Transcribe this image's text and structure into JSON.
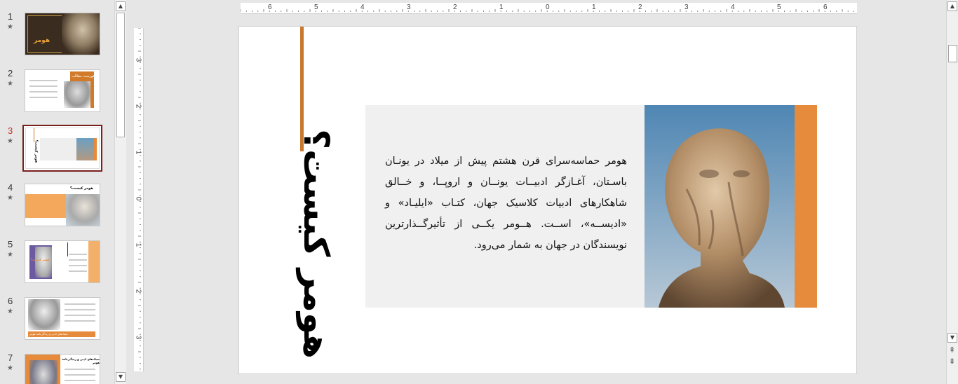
{
  "slides": [
    {
      "number": "1",
      "star": "★",
      "title": "هومر"
    },
    {
      "number": "2",
      "star": "★",
      "title": "فهرست مطالب"
    },
    {
      "number": "3",
      "star": "★",
      "title": "هومر کیست؟"
    },
    {
      "number": "4",
      "star": "★",
      "title": "هومر کیست؟"
    },
    {
      "number": "5",
      "star": "★",
      "title": "هومر کیست؟"
    },
    {
      "number": "6",
      "star": "★",
      "title": "سبک‌های ادبی و زندگی‌نامه هومر"
    },
    {
      "number": "7",
      "star": "★",
      "title": "سبک‌های ادبی و زندگی‌نامه هومر"
    }
  ],
  "selected_slide": "3",
  "ruler": {
    "horizontal": [
      "6",
      "5",
      "4",
      "3",
      "2",
      "1",
      "0",
      "1",
      "2",
      "3",
      "4",
      "5",
      "6"
    ],
    "vertical": [
      "3",
      "2",
      "1",
      "0",
      "1",
      "2",
      "3"
    ]
  },
  "slide": {
    "title": "هومر کیست؟",
    "body": "هومر حماسه‌سرای قرن هشتم پیش از میلاد در یونـان باسـتان، آغـازگر ادبیــات یونــان و اروپــا، و خــالق شاهکارهای ادبیات کلاسیک جهان، کتـاب «ایلیـاد» و «ادیســه»، اســت. هــومر یکــی از تأثیرگــذارترین نویسندگان در جهان به شمار می‌رود.",
    "colors": {
      "accent_line": "#c8792e",
      "orange_bar": "#e58b3b",
      "text_box": "#f0f0f0"
    }
  },
  "scrollbars": {
    "up": "▲",
    "down": "▼",
    "prev_slide": "⇞",
    "next_slide": "⇟"
  },
  "icons": {
    "slide_star": "star-icon",
    "photo": "homer-bust-photo"
  }
}
